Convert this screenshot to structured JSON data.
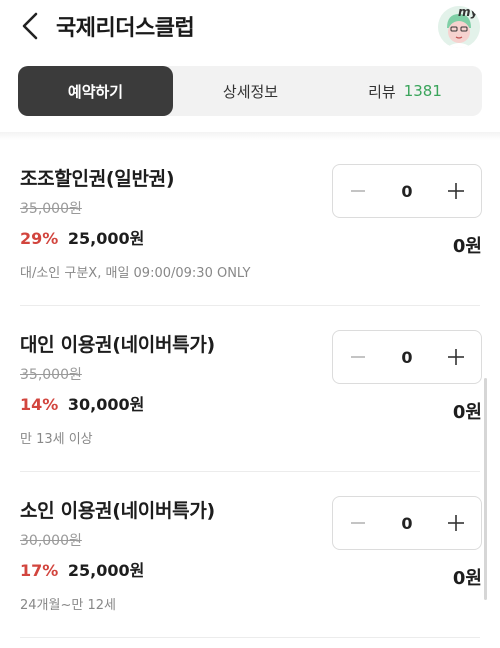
{
  "header": {
    "title": "국제리더스클럽",
    "back_icon": "chevron-left-icon",
    "avatar_label": "my"
  },
  "tabs": [
    {
      "label": "예약하기",
      "active": true
    },
    {
      "label": "상세정보",
      "active": false
    },
    {
      "label": "리뷰",
      "count": "1381",
      "active": false
    }
  ],
  "colors": {
    "accent_discount": "#d2453e",
    "review_count": "#3aa45b",
    "active_tab_bg": "#3b3b3b"
  },
  "items": [
    {
      "name": "조조할인권(일반권)",
      "original_price": "35,000원",
      "discount": "29%",
      "price": "25,000원",
      "note": "대/소인 구분X, 매일 09:00/09:30 ONLY",
      "quantity": "0",
      "total": "0원"
    },
    {
      "name": "대인 이용권(네이버특가)",
      "original_price": "35,000원",
      "discount": "14%",
      "price": "30,000원",
      "note": "만 13세 이상",
      "quantity": "0",
      "total": "0원"
    },
    {
      "name": "소인 이용권(네이버특가)",
      "original_price": "30,000원",
      "discount": "17%",
      "price": "25,000원",
      "note": "24개월~만 12세",
      "quantity": "0",
      "total": "0원"
    }
  ]
}
